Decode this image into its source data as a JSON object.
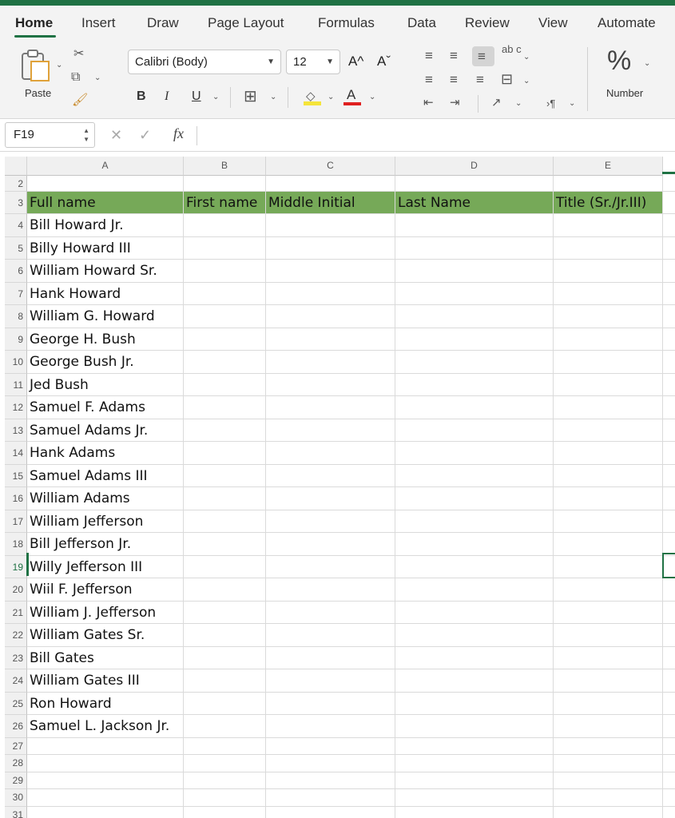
{
  "ribbon_tabs": [
    "Home",
    "Insert",
    "Draw",
    "Page Layout",
    "Formulas",
    "Data",
    "Review",
    "View",
    "Automate"
  ],
  "active_tab": "Home",
  "clipboard": {
    "paste_label": "Paste"
  },
  "font": {
    "name": "Calibri (Body)",
    "size": "12",
    "bold": "B",
    "italic": "I",
    "underline": "U",
    "grow": "A^",
    "shrink": "Aˇ",
    "font_color_glyph": "A"
  },
  "alignment": {
    "wrap_glyph": "ab c"
  },
  "number": {
    "label": "Number",
    "percent": "%"
  },
  "formula_bar": {
    "name_box": "F19",
    "fx": "fx",
    "formula": ""
  },
  "colors": {
    "accent": "#1f7244",
    "header_fill": "#76a958"
  },
  "columns": [
    "A",
    "B",
    "C",
    "D",
    "E"
  ],
  "header_row": {
    "row": "3",
    "cells": [
      "Full name",
      "First name",
      "Middle Initial",
      "Last Name",
      "Title (Sr./Jr.III)"
    ]
  },
  "rows": [
    {
      "num": "4",
      "full_name": "Bill Howard Jr."
    },
    {
      "num": "5",
      "full_name": "Billy Howard III"
    },
    {
      "num": "6",
      "full_name": "William Howard Sr."
    },
    {
      "num": "7",
      "full_name": "Hank Howard"
    },
    {
      "num": "8",
      "full_name": "William G. Howard"
    },
    {
      "num": "9",
      "full_name": "George H. Bush"
    },
    {
      "num": "10",
      "full_name": "George Bush Jr."
    },
    {
      "num": "11",
      "full_name": "Jed Bush"
    },
    {
      "num": "12",
      "full_name": "Samuel F. Adams"
    },
    {
      "num": "13",
      "full_name": "Samuel Adams Jr."
    },
    {
      "num": "14",
      "full_name": "Hank Adams"
    },
    {
      "num": "15",
      "full_name": "Samuel Adams III"
    },
    {
      "num": "16",
      "full_name": "William Adams"
    },
    {
      "num": "17",
      "full_name": "William Jefferson"
    },
    {
      "num": "18",
      "full_name": "Bill Jefferson Jr."
    },
    {
      "num": "19",
      "full_name": "Willy Jefferson III"
    },
    {
      "num": "20",
      "full_name": "Wiil F. Jefferson"
    },
    {
      "num": "21",
      "full_name": "William J. Jefferson"
    },
    {
      "num": "22",
      "full_name": "William Gates Sr."
    },
    {
      "num": "23",
      "full_name": "Bill Gates"
    },
    {
      "num": "24",
      "full_name": "William Gates III"
    },
    {
      "num": "25",
      "full_name": "Ron Howard"
    },
    {
      "num": "26",
      "full_name": "Samuel L. Jackson Jr."
    }
  ],
  "empty_rows": [
    "27",
    "28",
    "29",
    "30",
    "31"
  ],
  "first_row": "2",
  "selected_row": "19"
}
